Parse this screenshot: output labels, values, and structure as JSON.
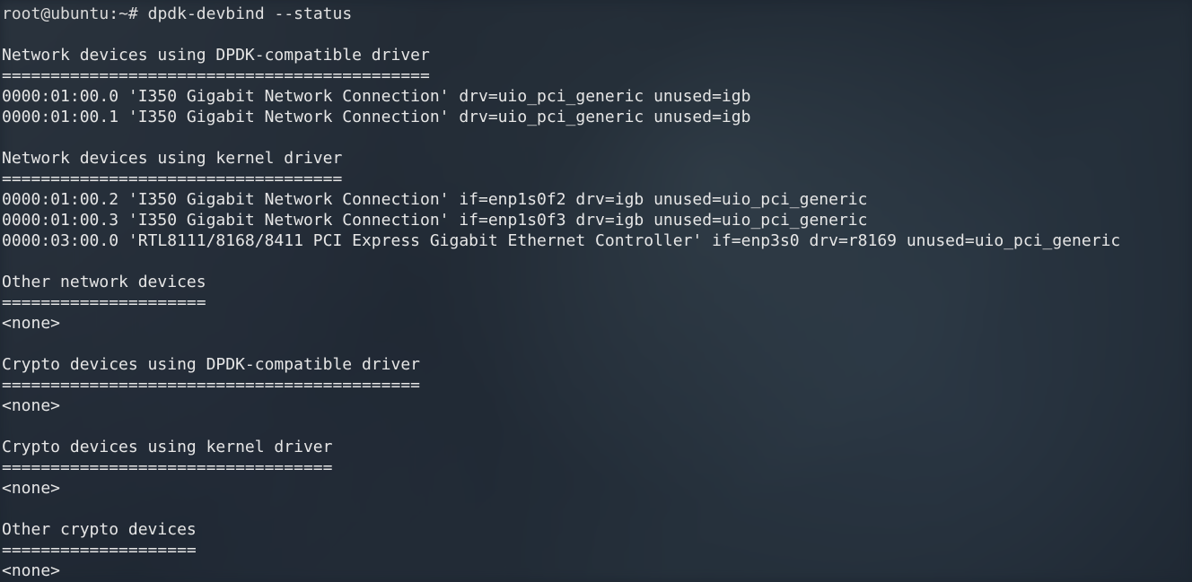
{
  "prompt": {
    "user": "root",
    "sep": "@",
    "host": "ubuntu",
    "path": "~",
    "symbol": "#"
  },
  "command": "dpdk-devbind --status",
  "sections": [
    {
      "title": "Network devices using DPDK-compatible driver",
      "underline": "============================================",
      "lines": [
        "0000:01:00.0 'I350 Gigabit Network Connection' drv=uio_pci_generic unused=igb",
        "0000:01:00.1 'I350 Gigabit Network Connection' drv=uio_pci_generic unused=igb"
      ]
    },
    {
      "title": "Network devices using kernel driver",
      "underline": "===================================",
      "lines": [
        "0000:01:00.2 'I350 Gigabit Network Connection' if=enp1s0f2 drv=igb unused=uio_pci_generic",
        "0000:01:00.3 'I350 Gigabit Network Connection' if=enp1s0f3 drv=igb unused=uio_pci_generic",
        "0000:03:00.0 'RTL8111/8168/8411 PCI Express Gigabit Ethernet Controller' if=enp3s0 drv=r8169 unused=uio_pci_generic"
      ]
    },
    {
      "title": "Other network devices",
      "underline": "=====================",
      "lines": [
        "<none>"
      ]
    },
    {
      "title": "Crypto devices using DPDK-compatible driver",
      "underline": "===========================================",
      "lines": [
        "<none>"
      ]
    },
    {
      "title": "Crypto devices using kernel driver",
      "underline": "==================================",
      "lines": [
        "<none>"
      ]
    },
    {
      "title": "Other crypto devices",
      "underline": "====================",
      "lines": [
        "<none>"
      ]
    }
  ]
}
